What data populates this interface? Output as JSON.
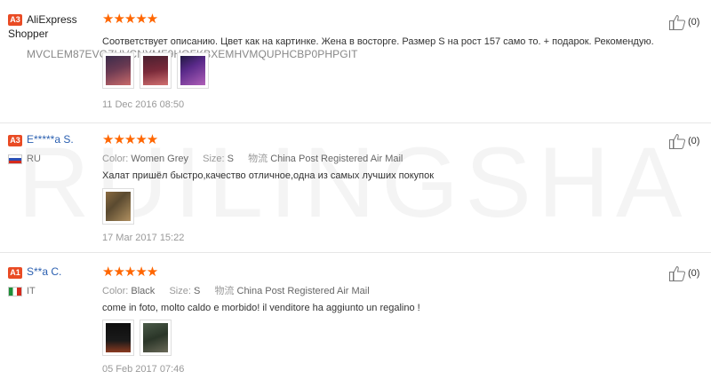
{
  "watermark": "RUILINGSHA",
  "reviews": [
    {
      "level": "A3",
      "name": "AliExpress",
      "name_line2": "Shopper",
      "code": "MVCLEM87EVGZHVCNYMF9HOFKBXEMHVMQUPHCBP0PHPGIT",
      "stars": "★★★★★",
      "text": "Соответствует описанию. Цвет как на картинке. Жена в восторге. Размер S на рост 157 само то. + подарок. Рекомендую.",
      "date": "11 Dec 2016 08:50",
      "helpful": "(0)"
    },
    {
      "level": "A3",
      "name": "E*****a S.",
      "country": "RU",
      "stars": "★★★★★",
      "color_label": "Color:",
      "color_value": "Women Grey",
      "size_label": "Size:",
      "size_value": "S",
      "logistics_label": "物流",
      "logistics_value": "China Post Registered Air Mail",
      "text": "Халат пришёл быстро,качество отличное,одна из самых лучших покупок",
      "date": "17 Mar 2017 15:22",
      "helpful": "(0)"
    },
    {
      "level": "A1",
      "name": "S**a C.",
      "country": "IT",
      "stars": "★★★★★",
      "color_label": "Color:",
      "color_value": "Black",
      "size_label": "Size:",
      "size_value": "S",
      "logistics_label": "物流",
      "logistics_value": "China Post Registered Air Mail",
      "text": "come in foto, molto caldo e morbido! il venditore ha aggiunto un regalino !",
      "date": "05 Feb 2017 07:46",
      "helpful": "(0)"
    }
  ]
}
